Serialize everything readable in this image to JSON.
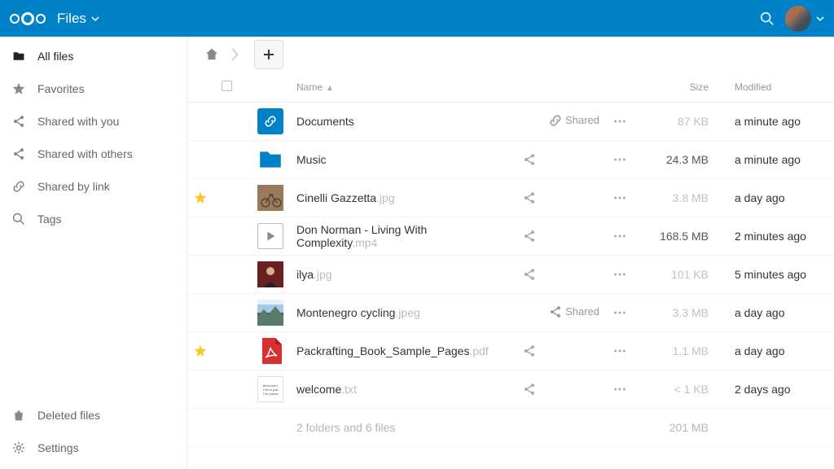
{
  "header": {
    "app_label": "Files"
  },
  "sidebar": {
    "items": [
      {
        "icon": "folder",
        "label": "All files",
        "active": true
      },
      {
        "icon": "star",
        "label": "Favorites"
      },
      {
        "icon": "share",
        "label": "Shared with you"
      },
      {
        "icon": "share",
        "label": "Shared with others"
      },
      {
        "icon": "link",
        "label": "Shared by link"
      },
      {
        "icon": "search",
        "label": "Tags"
      }
    ],
    "bottom": [
      {
        "icon": "trash",
        "label": "Deleted files"
      },
      {
        "icon": "gear",
        "label": "Settings"
      }
    ]
  },
  "columns": {
    "name": "Name",
    "size": "Size",
    "modified": "Modified"
  },
  "shared_label": "Shared",
  "files": [
    {
      "starred": false,
      "thumb": "link-folder",
      "name": "Documents",
      "ext": "",
      "shared": "link",
      "size": "87 KB",
      "size_dim": true,
      "modified": "a minute ago"
    },
    {
      "starred": false,
      "thumb": "folder",
      "name": "Music",
      "ext": "",
      "shared": "icon",
      "size": "24.3 MB",
      "modified": "a minute ago"
    },
    {
      "starred": true,
      "thumb": "img-bike",
      "name": "Cinelli Gazzetta",
      "ext": ".jpg",
      "shared": "icon",
      "size": "3.8 MB",
      "size_dim": true,
      "modified": "a day ago"
    },
    {
      "starred": false,
      "thumb": "video",
      "name": "Don Norman - Living With Complexity",
      "ext": ".mp4",
      "shared": "icon",
      "size": "168.5 MB",
      "modified": "2 minutes ago"
    },
    {
      "starred": false,
      "thumb": "img-person",
      "name": "ilya",
      "ext": ".jpg",
      "shared": "icon",
      "size": "101 KB",
      "size_dim": true,
      "modified": "5 minutes ago"
    },
    {
      "starred": false,
      "thumb": "img-mountain",
      "name": "Montenegro cycling",
      "ext": ".jpeg",
      "shared": "shared",
      "size": "3.3 MB",
      "size_dim": true,
      "modified": "a day ago"
    },
    {
      "starred": true,
      "thumb": "pdf",
      "name": "Packrafting_Book_Sample_Pages",
      "ext": ".pdf",
      "shared": "icon",
      "size": "1.1 MB",
      "size_dim": true,
      "modified": "a day ago"
    },
    {
      "starred": false,
      "thumb": "txt",
      "name": "welcome",
      "ext": ".txt",
      "shared": "icon",
      "size": "< 1 KB",
      "size_dim": true,
      "modified": "2 days ago"
    }
  ],
  "summary": {
    "text": "2 folders and 6 files",
    "size": "201 MB"
  }
}
